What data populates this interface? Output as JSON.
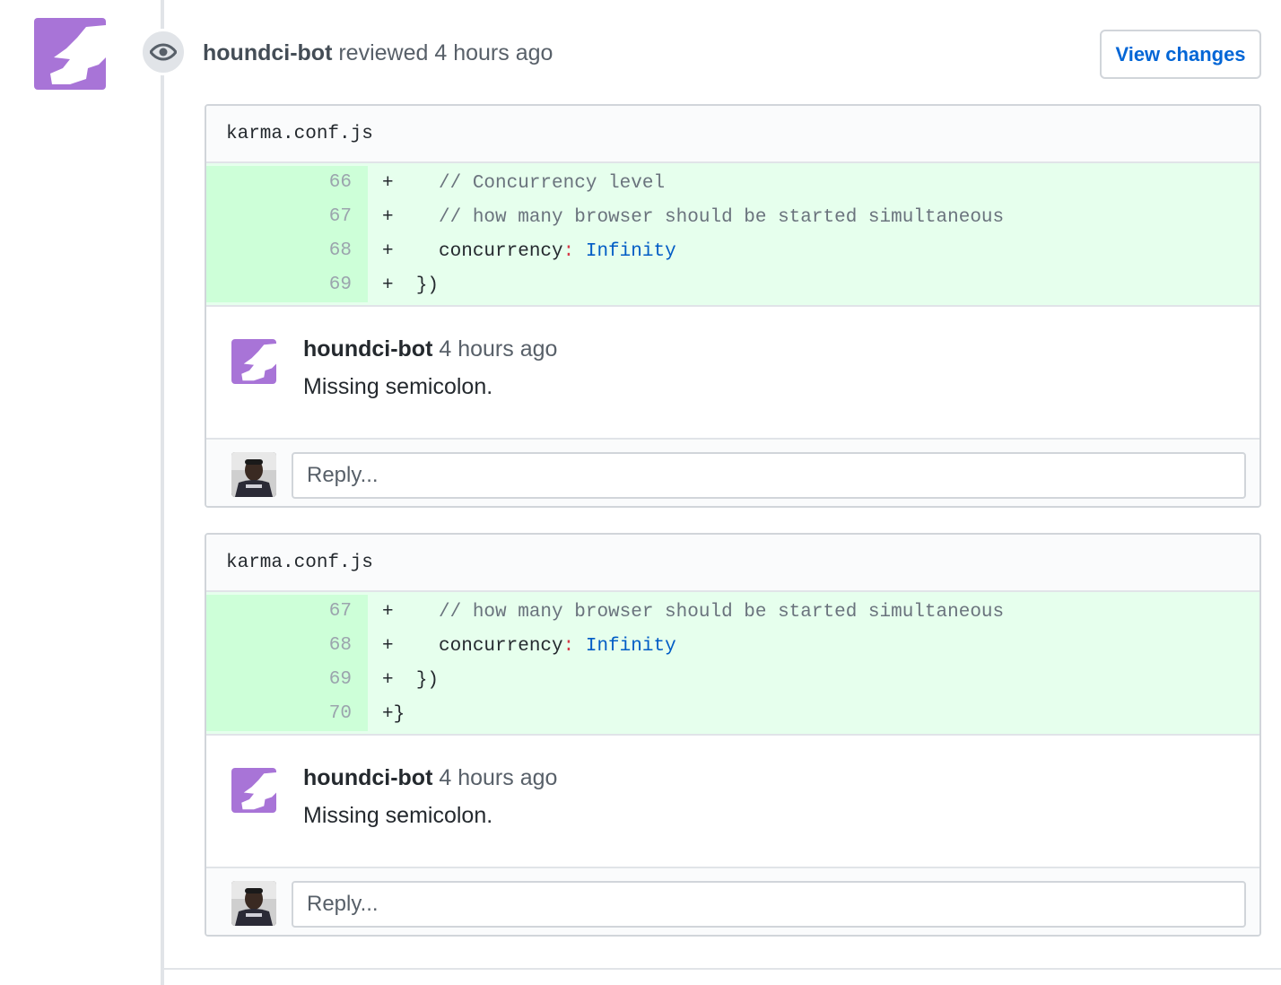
{
  "review": {
    "author": "houndci-bot",
    "action": "reviewed",
    "time": "4 hours ago",
    "view_changes_label": "View changes",
    "avatar_color": "#a874d7",
    "event_icon": "eye-icon"
  },
  "threads": [
    {
      "filename": "karma.conf.js",
      "lines": [
        {
          "num": "66",
          "sign": "+",
          "text": "    // Concurrency level"
        },
        {
          "num": "67",
          "sign": "+",
          "text": "    // how many browser should be started simultaneous"
        },
        {
          "num": "68",
          "sign": "+",
          "text": "    concurrency: Infinity"
        },
        {
          "num": "69",
          "sign": "+",
          "text": "  })"
        }
      ],
      "comment": {
        "author": "houndci-bot",
        "time": "4 hours ago",
        "body": "Missing semicolon."
      },
      "reply_placeholder": "Reply..."
    },
    {
      "filename": "karma.conf.js",
      "lines": [
        {
          "num": "67",
          "sign": "+",
          "text": "    // how many browser should be started simultaneous"
        },
        {
          "num": "68",
          "sign": "+",
          "text": "    concurrency: Infinity"
        },
        {
          "num": "69",
          "sign": "+",
          "text": "  })"
        },
        {
          "num": "70",
          "sign": "+",
          "text": "}"
        }
      ],
      "comment": {
        "author": "houndci-bot",
        "time": "4 hours ago",
        "body": "Missing semicolon."
      },
      "reply_placeholder": "Reply..."
    }
  ],
  "colors": {
    "added_line_bg": "#e6ffed",
    "added_num_bg": "#cdffd8",
    "link_blue": "#0366d6",
    "border": "#d1d5da"
  }
}
